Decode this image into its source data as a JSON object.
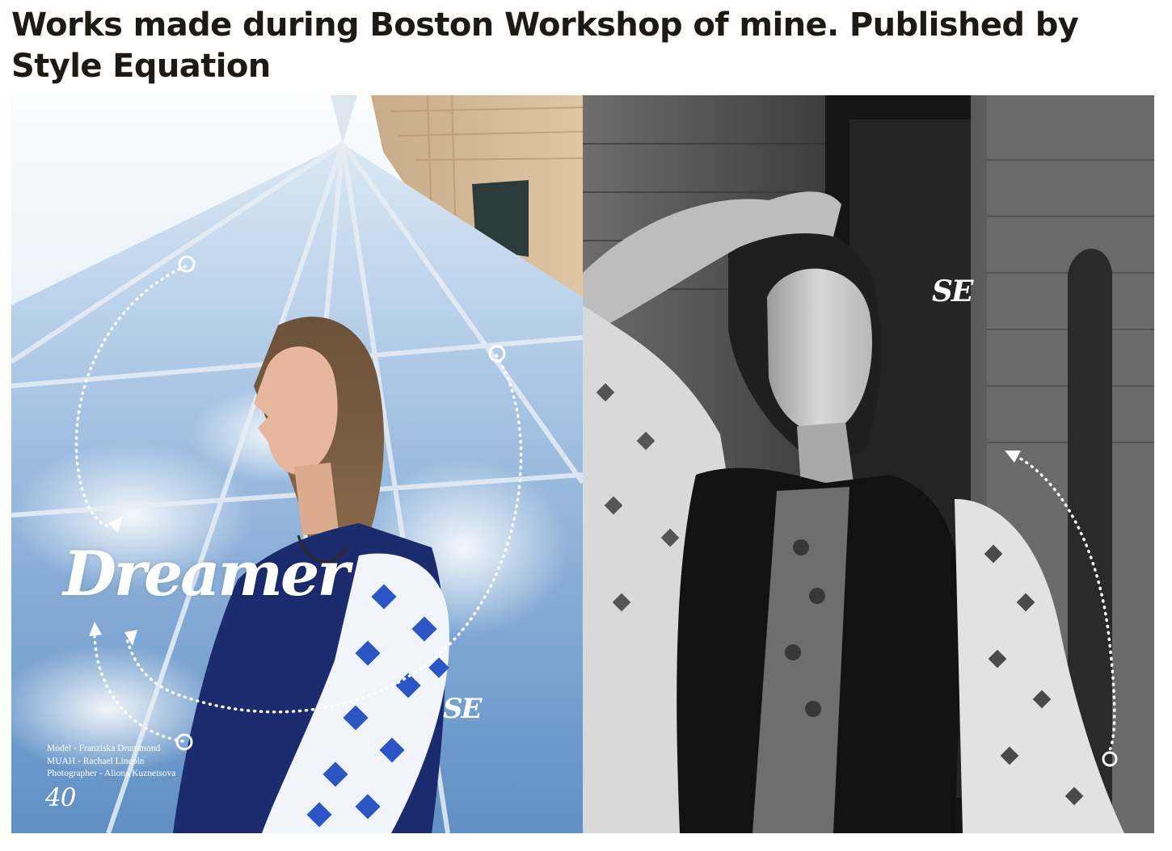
{
  "post": {
    "title": "Works made during Boston Workshop of mine. Published by Style Equation"
  },
  "magazine_spread": {
    "left_page": {
      "headline": "Dreamer",
      "credits": [
        "Model - Franziska Drummond",
        "MUAH - Rachael Lincoln",
        "Photographer - Aliona Kuznetsova"
      ],
      "page_number": "40",
      "logo": "SE"
    },
    "right_page": {
      "logo": "SE"
    }
  },
  "colors": {
    "title_text": "#1d1a16",
    "vest_navy": "#1b2b6e",
    "print_blue": "#2b55c4",
    "sky_blue": "#7ea9d6",
    "overlay_white": "#ffffff"
  }
}
